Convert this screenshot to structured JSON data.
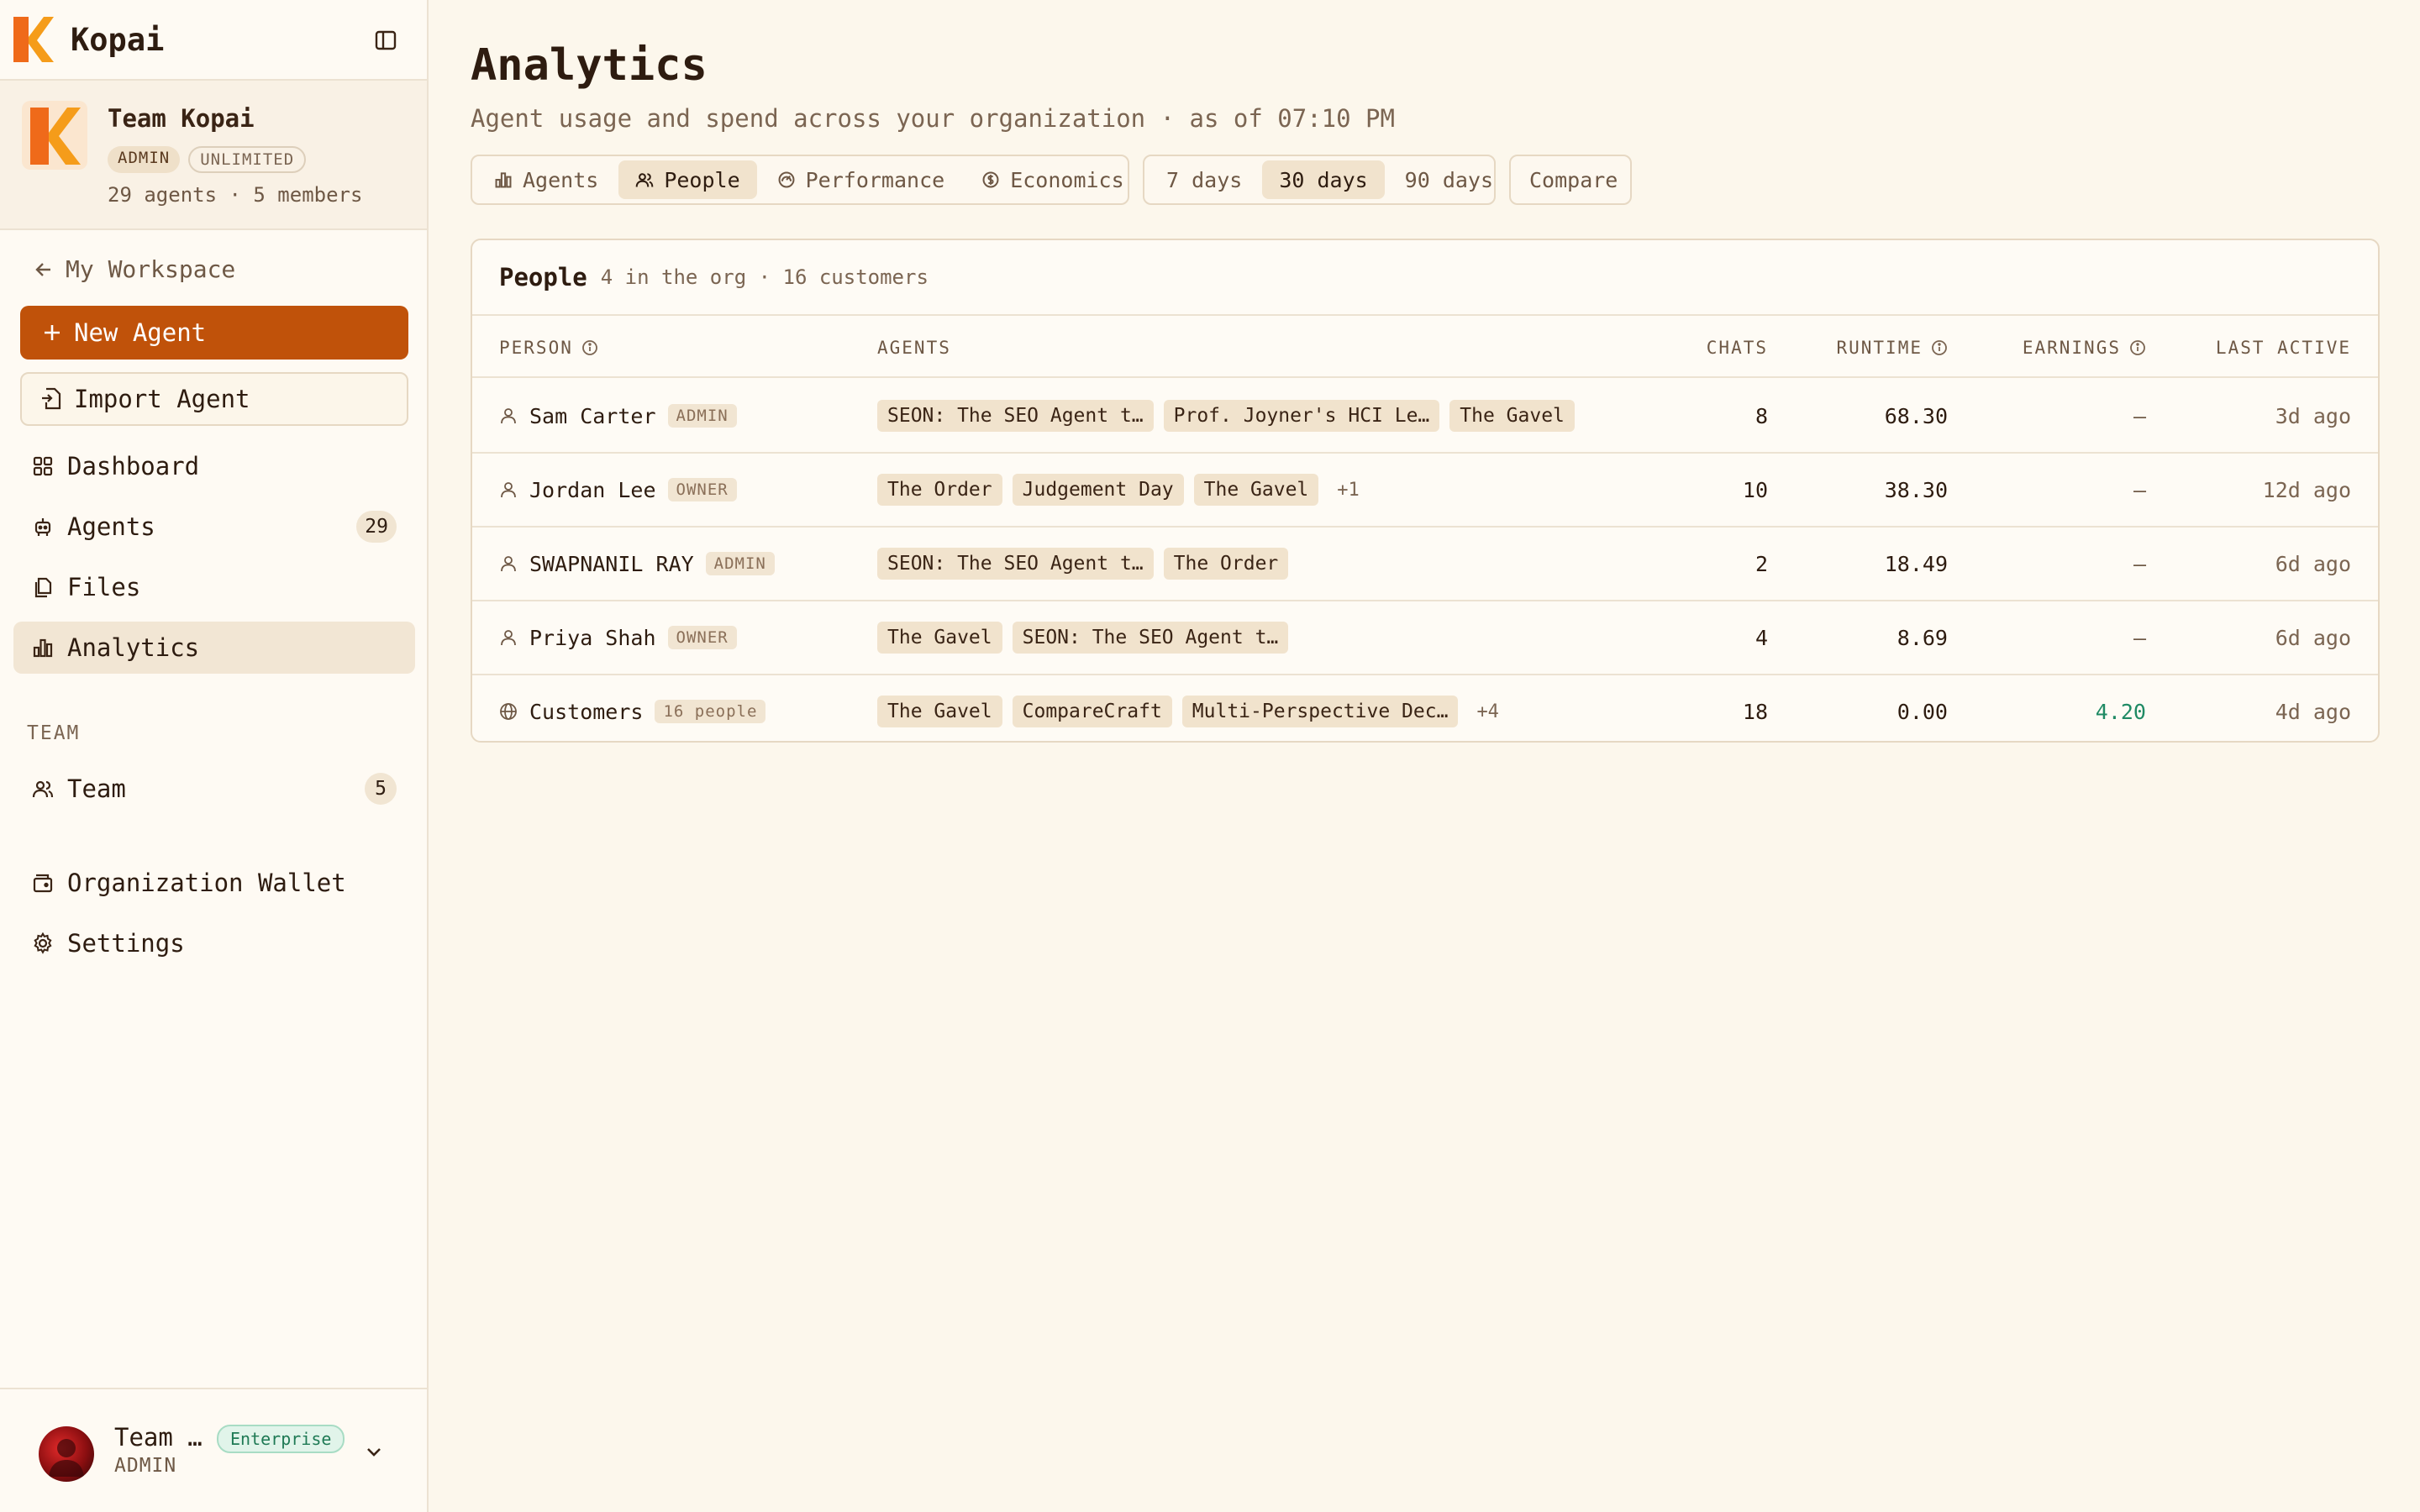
{
  "app": {
    "name": "Kopai"
  },
  "team": {
    "name": "Team Kopai",
    "badges": [
      "ADMIN",
      "UNLIMITED"
    ],
    "meta": "29 agents · 5 members"
  },
  "nav": {
    "back": "My Workspace",
    "new_agent": "New Agent",
    "import_agent": "Import Agent",
    "items": [
      {
        "label": "Dashboard",
        "icon": "grid-icon"
      },
      {
        "label": "Agents",
        "icon": "robot-icon",
        "count": "29"
      },
      {
        "label": "Files",
        "icon": "files-icon"
      },
      {
        "label": "Analytics",
        "icon": "bar-chart-icon",
        "active": true
      }
    ],
    "team_section": "TEAM",
    "team_item": {
      "label": "Team",
      "count": "5"
    },
    "wallet": "Organization Wallet",
    "settings": "Settings"
  },
  "user": {
    "name": "Team …",
    "role": "ADMIN",
    "plan": "Enterprise"
  },
  "page": {
    "title": "Analytics",
    "subtitle": "Agent usage and spend across your organization · as of 07:10 PM"
  },
  "tabs": [
    {
      "label": "Agents",
      "icon": "bar-chart-icon"
    },
    {
      "label": "People",
      "icon": "users-icon",
      "active": true
    },
    {
      "label": "Performance",
      "icon": "gauge-icon"
    },
    {
      "label": "Economics",
      "icon": "dollar-icon"
    }
  ],
  "ranges": [
    {
      "label": "7 days"
    },
    {
      "label": "30 days",
      "active": true
    },
    {
      "label": "90 days"
    }
  ],
  "compare": "Compare",
  "table": {
    "title": "People",
    "meta": "4 in the org · 16 customers",
    "headers": {
      "person": "PERSON",
      "agents": "AGENTS",
      "chats": "CHATS",
      "runtime": "RUNTIME",
      "earnings": "EARNINGS",
      "last_active": "LAST ACTIVE"
    },
    "rows": [
      {
        "name": "Sam Carter",
        "role": "ADMIN",
        "icon": "user-icon",
        "agents": [
          "SEON: The SEO Agent t…",
          "Prof. Joyner's HCI Le…",
          "The Gavel"
        ],
        "more": "",
        "chats": "8",
        "runtime": "68.30",
        "earnings": "—",
        "last_active": "3d ago"
      },
      {
        "name": "Jordan Lee",
        "role": "OWNER",
        "icon": "user-icon",
        "agents": [
          "The Order",
          "Judgement Day",
          "The Gavel"
        ],
        "more": "+1",
        "chats": "10",
        "runtime": "38.30",
        "earnings": "—",
        "last_active": "12d ago"
      },
      {
        "name": "SWAPNANIL RAY",
        "role": "ADMIN",
        "icon": "user-icon",
        "agents": [
          "SEON: The SEO Agent t…",
          "The Order"
        ],
        "more": "",
        "chats": "2",
        "runtime": "18.49",
        "earnings": "—",
        "last_active": "6d ago"
      },
      {
        "name": "Priya Shah",
        "role": "OWNER",
        "icon": "user-icon",
        "agents": [
          "The Gavel",
          "SEON: The SEO Agent t…"
        ],
        "more": "",
        "chats": "4",
        "runtime": "8.69",
        "earnings": "—",
        "last_active": "6d ago"
      },
      {
        "name": "Customers",
        "role": "16 people",
        "icon": "globe-icon",
        "agents": [
          "The Gavel",
          "CompareCraft",
          "Multi-Perspective Dec…"
        ],
        "more": "+4",
        "chats": "18",
        "runtime": "0.00",
        "earnings": "4.20",
        "last_active": "4d ago"
      }
    ]
  },
  "colors": {
    "accent": "#c0520a",
    "background": "#fcf7ec",
    "positive": "#1f8a64"
  }
}
